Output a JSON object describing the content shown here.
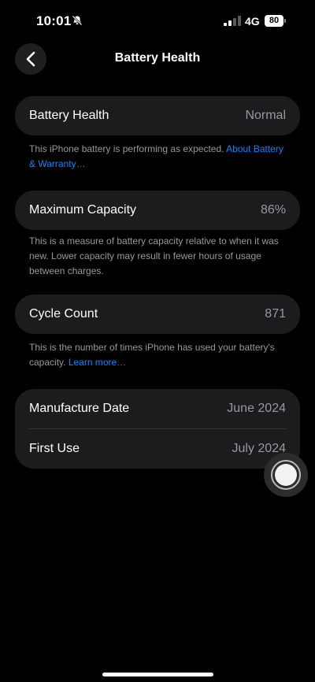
{
  "status": {
    "time": "10:01",
    "network": "4G",
    "battery": "80"
  },
  "nav": {
    "title": "Battery Health",
    "back_icon": "chevron-left-icon"
  },
  "battery_health": {
    "label": "Battery Health",
    "value": "Normal",
    "note": "This iPhone battery is performing as expected.",
    "link": "About Battery & Warranty…"
  },
  "max_capacity": {
    "label": "Maximum Capacity",
    "value": "86%",
    "note": "This is a measure of battery capacity relative to when it was new. Lower capacity may result in fewer hours of usage between charges."
  },
  "cycle_count": {
    "label": "Cycle Count",
    "value": "871",
    "note": "This is the number of times iPhone has used your battery's capacity.",
    "link": "Learn more…"
  },
  "dates": {
    "manufacture_label": "Manufacture Date",
    "manufacture_value": "June 2024",
    "first_use_label": "First Use",
    "first_use_value": "July 2024"
  },
  "colors": {
    "background": "#000000",
    "card": "#1c1c1e",
    "link": "#0a84ff",
    "secondary_text": "#98989d"
  }
}
